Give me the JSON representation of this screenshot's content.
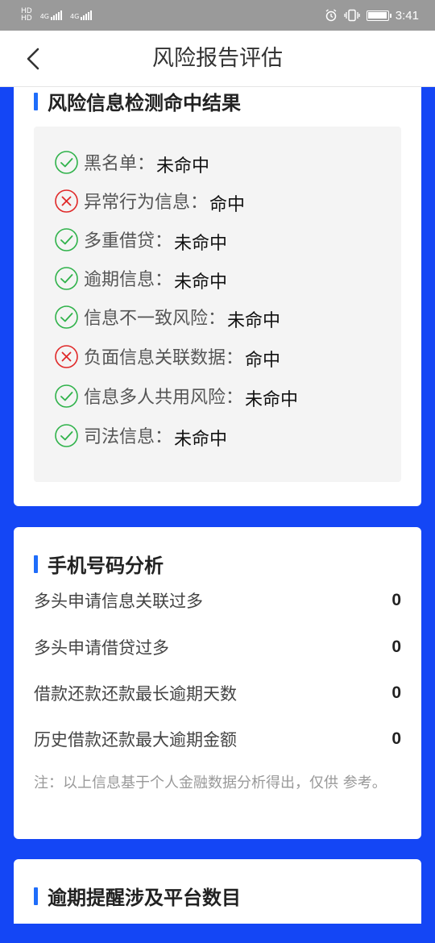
{
  "status_bar": {
    "network_left_top": "HD",
    "network_left_bottom": "HD",
    "sig1_label": "4G",
    "sig2_label": "4G",
    "time": "3:41"
  },
  "header": {
    "title": "风险报告评估"
  },
  "risk_section": {
    "title": "风险信息检测命中结果",
    "items": [
      {
        "label": "黑名单：",
        "value": "未命中",
        "status": "pass"
      },
      {
        "label": "异常行为信息：",
        "value": "命中",
        "status": "hit"
      },
      {
        "label": "多重借贷：",
        "value": "未命中",
        "status": "pass"
      },
      {
        "label": "逾期信息：",
        "value": "未命中",
        "status": "pass"
      },
      {
        "label": "信息不一致风险：",
        "value": "未命中",
        "status": "pass"
      },
      {
        "label": "负面信息关联数据：",
        "value": "命中",
        "status": "hit"
      },
      {
        "label": "信息多人共用风险：",
        "value": "未命中",
        "status": "pass"
      },
      {
        "label": "司法信息：",
        "value": "未命中",
        "status": "pass"
      }
    ]
  },
  "phone_section": {
    "title": "手机号码分析",
    "rows": [
      {
        "label": "多头申请信息关联过多",
        "value": "0"
      },
      {
        "label": "多头申请借贷过多",
        "value": "0"
      },
      {
        "label": "借款还款还款最长逾期天数",
        "value": "0"
      },
      {
        "label": "历史借款还款最大逾期金额",
        "value": "0"
      }
    ],
    "note": "注：以上信息基于个人金融数据分析得出，仅供 参考。"
  },
  "overdue_section": {
    "title": "逾期提醒涉及平台数目"
  },
  "colors": {
    "background": "#1446f5",
    "accent": "#1f6dfa",
    "pass": "#2fb24a",
    "hit": "#e02828"
  }
}
